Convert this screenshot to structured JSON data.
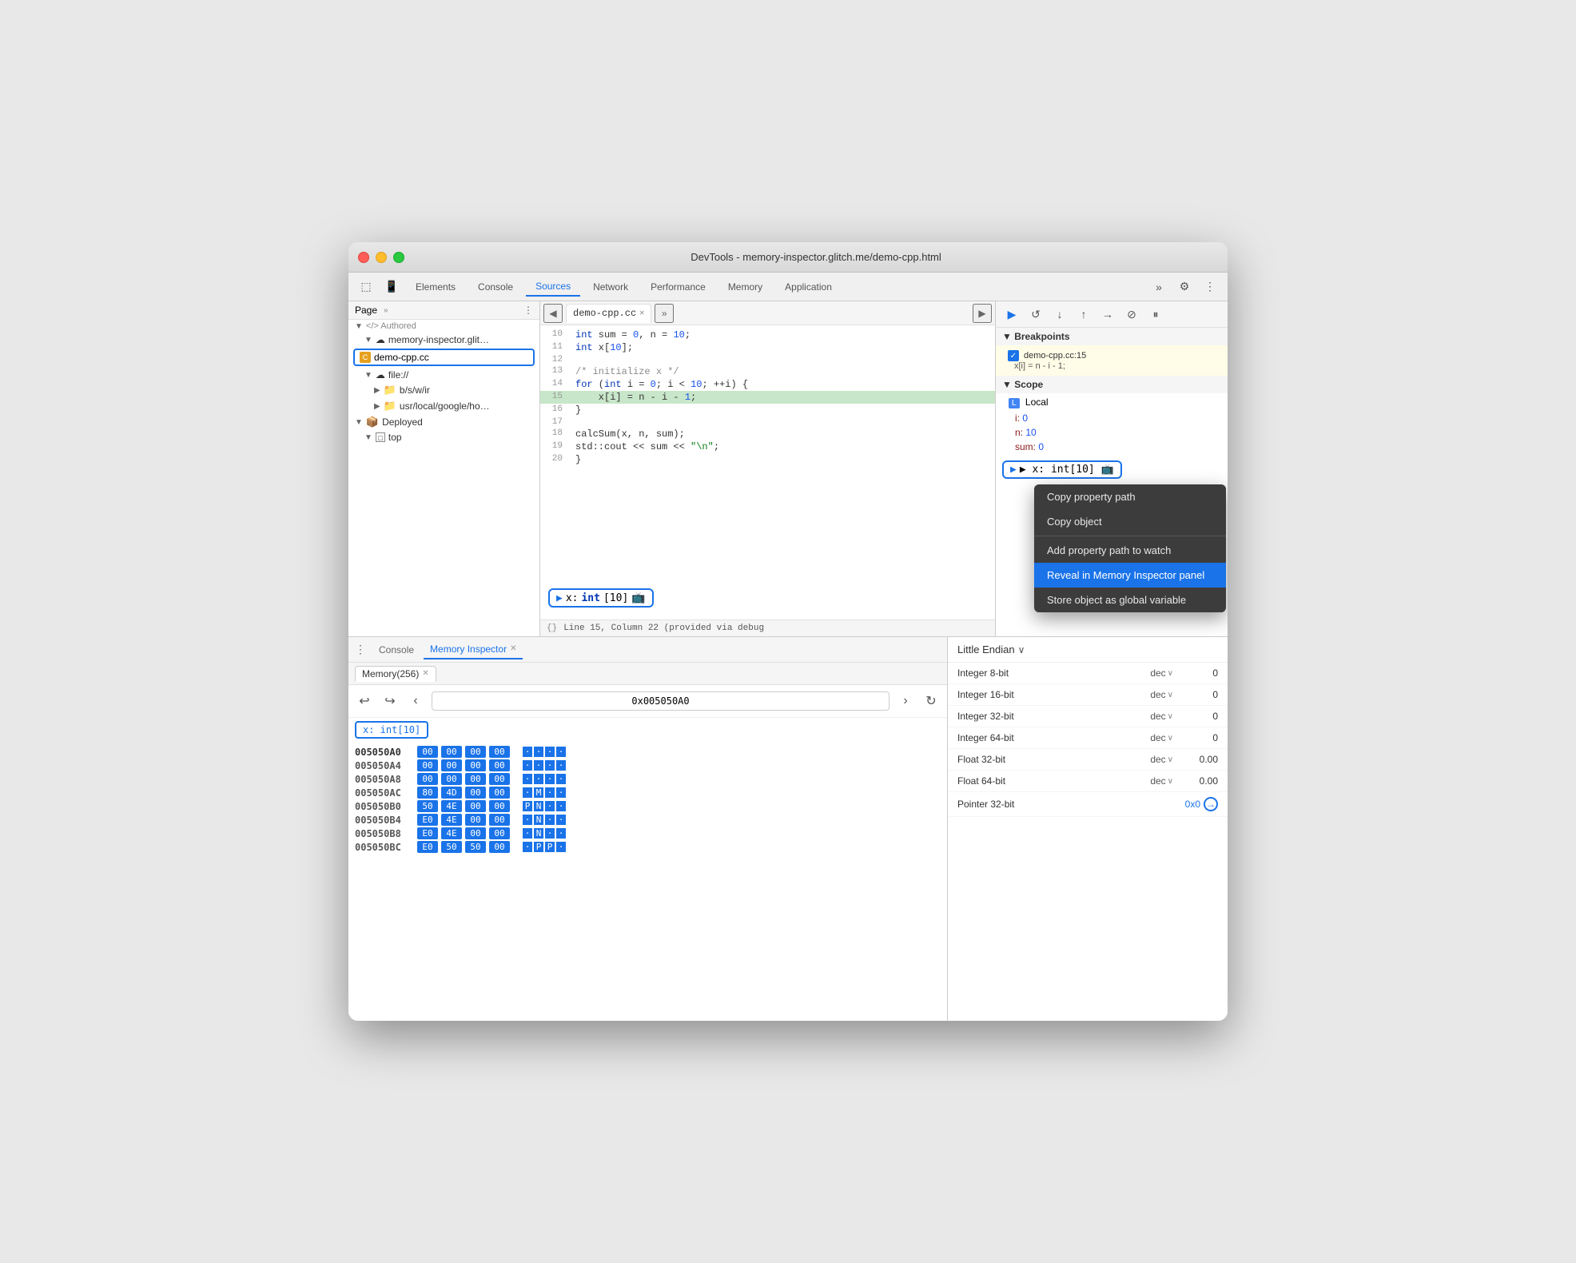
{
  "window": {
    "title": "DevTools - memory-inspector.glitch.me/demo-cpp.html"
  },
  "nav": {
    "tabs": [
      {
        "label": "Elements",
        "active": false
      },
      {
        "label": "Console",
        "active": false
      },
      {
        "label": "Sources",
        "active": true
      },
      {
        "label": "Network",
        "active": false
      },
      {
        "label": "Performance",
        "active": false
      },
      {
        "label": "Memory",
        "active": false
      },
      {
        "label": "Application",
        "active": false
      }
    ]
  },
  "left_panel": {
    "header": "Page",
    "tree": [
      {
        "label": "</> Authored",
        "indent": 0,
        "type": "section"
      },
      {
        "label": "memory-inspector.glit…",
        "indent": 1,
        "type": "cloud"
      },
      {
        "label": "demo-cpp.cc",
        "indent": 2,
        "type": "file",
        "selected": true
      },
      {
        "label": "file://",
        "indent": 1,
        "type": "cloud"
      },
      {
        "label": "b/s/w/ir",
        "indent": 2,
        "type": "folder"
      },
      {
        "label": "usr/local/google/ho…",
        "indent": 2,
        "type": "folder"
      },
      {
        "label": "Deployed",
        "indent": 0,
        "type": "section"
      },
      {
        "label": "top",
        "indent": 1,
        "type": "box"
      }
    ]
  },
  "source": {
    "tab_label": "demo-cpp.cc",
    "lines": [
      {
        "num": 10,
        "content": "    int sum = 0, n = 10;",
        "active": false
      },
      {
        "num": 11,
        "content": "    int x[10];",
        "active": false
      },
      {
        "num": 12,
        "content": "",
        "active": false
      },
      {
        "num": 13,
        "content": "    /* initialize x */",
        "active": false
      },
      {
        "num": 14,
        "content": "    for (int i = 0; i < 10; ++i) {",
        "active": false
      },
      {
        "num": 15,
        "content": "        x[i] = n - i - 1;",
        "active": true
      },
      {
        "num": 16,
        "content": "    }",
        "active": false
      },
      {
        "num": 17,
        "content": "",
        "active": false
      },
      {
        "num": 18,
        "content": "    calcSum(x, n, sum);",
        "active": false
      },
      {
        "num": 19,
        "content": "    std::cout << sum << \"\\n\";",
        "active": false
      },
      {
        "num": 20,
        "content": "}",
        "active": false
      }
    ],
    "status": "Line 15, Column 22 (provided via debug"
  },
  "right_panel": {
    "breakpoints_section": "▼ Breakpoints",
    "breakpoint": {
      "label": "demo-cpp.cc:15",
      "code": "x[i] = n - i - 1;"
    },
    "scope_section": "▼ Scope",
    "scope_local": "▼ L  Local",
    "scope_vars": [
      {
        "name": "i:",
        "value": "0"
      },
      {
        "name": "n:",
        "value": "10"
      },
      {
        "name": "sum:",
        "value": "0"
      }
    ],
    "var_box_label": "▶ x: int[10] 📺"
  },
  "bottom_tabs": {
    "console_label": "Console",
    "memory_inspector_label": "Memory Inspector",
    "memory_tab_label": "Memory(256)"
  },
  "memory_inspector": {
    "address": "0x005050A0",
    "tag": "x: int[10]",
    "endian": "Little Endian",
    "rows": [
      {
        "addr": "005050A0",
        "bytes": [
          "00",
          "00",
          "00",
          "00"
        ],
        "chars": [
          "·",
          "·",
          "·",
          "·"
        ],
        "highlight": true
      },
      {
        "addr": "005050A4",
        "bytes": [
          "00",
          "00",
          "00",
          "00"
        ],
        "chars": [
          "·",
          "·",
          "·",
          "·"
        ],
        "highlight": false
      },
      {
        "addr": "005050A8",
        "bytes": [
          "00",
          "00",
          "00",
          "00"
        ],
        "chars": [
          "·",
          "·",
          "·",
          "·"
        ],
        "highlight": false
      },
      {
        "addr": "005050AC",
        "bytes": [
          "80",
          "4D",
          "00",
          "00"
        ],
        "chars": [
          "·",
          "M",
          "·",
          "·"
        ],
        "highlight": false
      },
      {
        "addr": "005050B0",
        "bytes": [
          "50",
          "4E",
          "00",
          "00"
        ],
        "chars": [
          "P",
          "N",
          "·",
          "·"
        ],
        "highlight": false
      },
      {
        "addr": "005050B4",
        "bytes": [
          "E0",
          "4E",
          "00",
          "00"
        ],
        "chars": [
          "·",
          "N",
          "·",
          "·"
        ],
        "highlight": false
      },
      {
        "addr": "005050B8",
        "bytes": [
          "E0",
          "4E",
          "00",
          "00"
        ],
        "chars": [
          "·",
          "N",
          "·",
          "·"
        ],
        "highlight": false
      },
      {
        "addr": "005050BC",
        "bytes": [
          "E0",
          "50",
          "50",
          "00"
        ],
        "chars": [
          "·",
          "P",
          "P",
          "·"
        ],
        "highlight": false
      }
    ]
  },
  "data_panel": {
    "endian": "Little Endian",
    "rows": [
      {
        "type": "Integer 8-bit",
        "format": "dec",
        "value": "0"
      },
      {
        "type": "Integer 16-bit",
        "format": "dec",
        "value": "0"
      },
      {
        "type": "Integer 32-bit",
        "format": "dec",
        "value": "0"
      },
      {
        "type": "Integer 64-bit",
        "format": "dec",
        "value": "0"
      },
      {
        "type": "Float 32-bit",
        "format": "dec",
        "value": "0.00"
      },
      {
        "type": "Float 64-bit",
        "format": "dec",
        "value": "0.00"
      },
      {
        "type": "Pointer 32-bit",
        "format": "",
        "value": "0x0"
      }
    ]
  },
  "context_menu": {
    "items": [
      {
        "label": "Copy property path",
        "active": false
      },
      {
        "label": "Copy object",
        "active": false
      },
      {
        "separator": true
      },
      {
        "label": "Add property path to watch",
        "active": false
      },
      {
        "label": "Reveal in Memory Inspector panel",
        "active": true
      },
      {
        "label": "Store object as global variable",
        "active": false
      }
    ]
  }
}
